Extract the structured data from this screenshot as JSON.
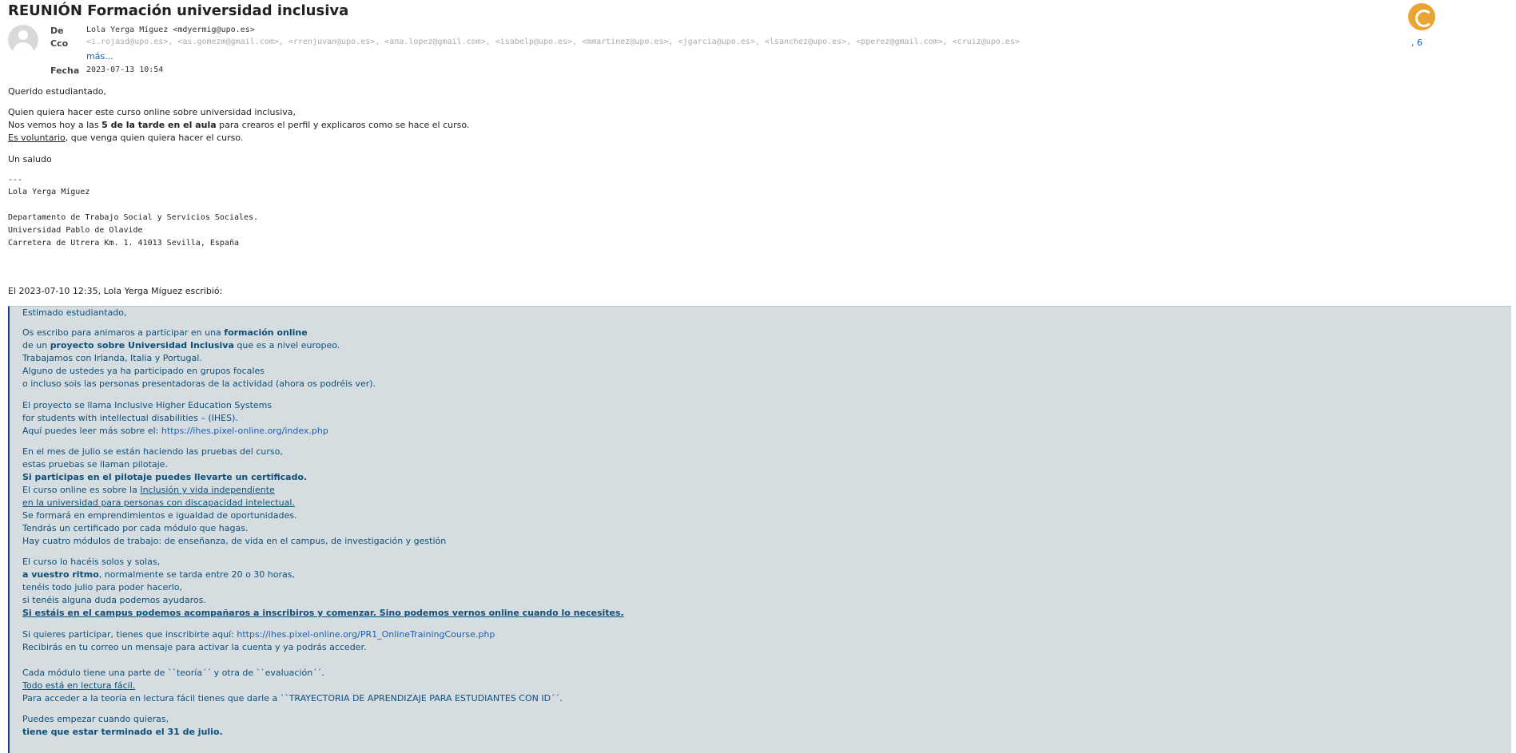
{
  "email": {
    "subject": "REUNIÓN Formación universidad inclusiva",
    "labels": {
      "from": "De",
      "cco": "Cco",
      "date": "Fecha"
    },
    "from": "Lola Yerga Míguez <mdyermig@upo.es>",
    "cco": "<i.rojasd@upo.es>, <as.gomezm@gmail.com>, <rrenjuvan@upo.es>, <ana.lopez@gmail.com>, <isabelp@upo.es>, <mmartinez@upo.es>, <jgarcia@upo.es>, <lsanchez@upo.es>, <pperez@gmail.com>, <cruiz@upo.es>",
    "more_count": "6",
    "more_label": "más...",
    "date": "2023-07-13 10:54"
  },
  "body": {
    "greeting": "Querido estudiantado,",
    "p1_line1": "Quien quiera hacer este curso online sobre universidad inclusiva,",
    "p1_line2_pre": "Nos vemos hoy a las ",
    "p1_line2_bold": "5 de la tarde en el aula",
    "p1_line2_post": " para crearos el perfil y explicaros como se hace el curso.",
    "p1_line3_ul": "Es voluntario",
    "p1_line3_post": ", que venga quien quiera hacer el curso.",
    "closing": "Un saludo"
  },
  "signature": {
    "sep": "---",
    "name": "Lola Yerga Míguez",
    "dept": "Departamento de Trabajo Social y Servicios Sociales.",
    "univ": "Universidad Pablo de Olavide",
    "addr": "Carretera de Utrera  Km. 1. 41013 Sevilla, España"
  },
  "quote_header": "El 2023-07-10 12:35, Lola Yerga Míguez escribió:",
  "quoted": {
    "l1": "Estimado estudiantado,",
    "l2_pre": "Os escribo para animaros a participar en una ",
    "l2_bold": "formación online",
    "l3_pre": "de un ",
    "l3_bold": "proyecto sobre Universidad Inclusiva",
    "l3_post": " que es a nivel europeo.",
    "l4": "Trabajamos con Irlanda, Italia y Portugal.",
    "l5": "Alguno de ustedes ya ha participado en grupos focales",
    "l6": "o incluso sois las personas presentadoras de la actividad (ahora os podréis ver).",
    "l7": "El proyecto se llama  Inclusive Higher Education Systems",
    "l8": "for students with intellectual disabilities – (IHES).",
    "l9_pre": "Aquí puedes leer más sobre el: ",
    "l9_link": "https://ihes.pixel-online.org/index.php",
    "l10": "En el mes de julio se están haciendo las pruebas del curso,",
    "l11": "estas pruebas se llaman pilotaje.",
    "l12": "Si participas en el pilotaje puedes llevarte un certificado.",
    "l13_pre": "El curso online es sobre la ",
    "l13_ul": "Inclusión y vida independiente",
    "l14_ul": "en la universidad para personas con discapacidad intelectual.",
    "l15": "Se formará en emprendimientos e igualdad de oportunidades.",
    "l16": "Tendrás un certificado por cada módulo que hagas.",
    "l17": "Hay cuatro módulos de trabajo: de enseñanza, de vida en el campus, de investigación y gestión",
    "l18": "El curso lo hacéis solos y solas,",
    "l19_bold": "a vuestro ritmo",
    "l19_post": ", normalmente se tarda entre 20 o 30 horas,",
    "l20": "tenéis todo julio para poder hacerlo,",
    "l21": "si tenéis alguna duda podemos ayudaros.",
    "l22": "Si estáis en el campus podemos acompañaros a inscribiros y comenzar. Sino podemos vernos online cuando lo necesites.",
    "l23_pre": "Si quieres participar, tienes que inscribirte aquí: ",
    "l23_link": "https://ihes.pixel-online.org/PR1_OnlineTrainingCourse.php",
    "l24": "Recibirás en tu correo un mensaje para activar la cuenta y ya podrás acceder.",
    "l25": "Cada módulo tiene una parte de ``teoría´´ y otra de ``evaluación´´.",
    "l26_ul": "Todo está en lectura fácil.",
    "l27": "Para acceder a la teoría en lectura fácil tienes que darle a ``TRAYECTORIA DE APRENDIZAJE PARA ESTUDIANTES CON ID´´.",
    "l28": "Puedes empezar cuando quieras,",
    "l29": "tiene que estar terminado el 31 de julio."
  },
  "colors": {
    "quote_bg": "#d5dde0",
    "quote_text": "#0e4f7a",
    "link": "#1a5fb4",
    "logo": "#e8a534"
  }
}
